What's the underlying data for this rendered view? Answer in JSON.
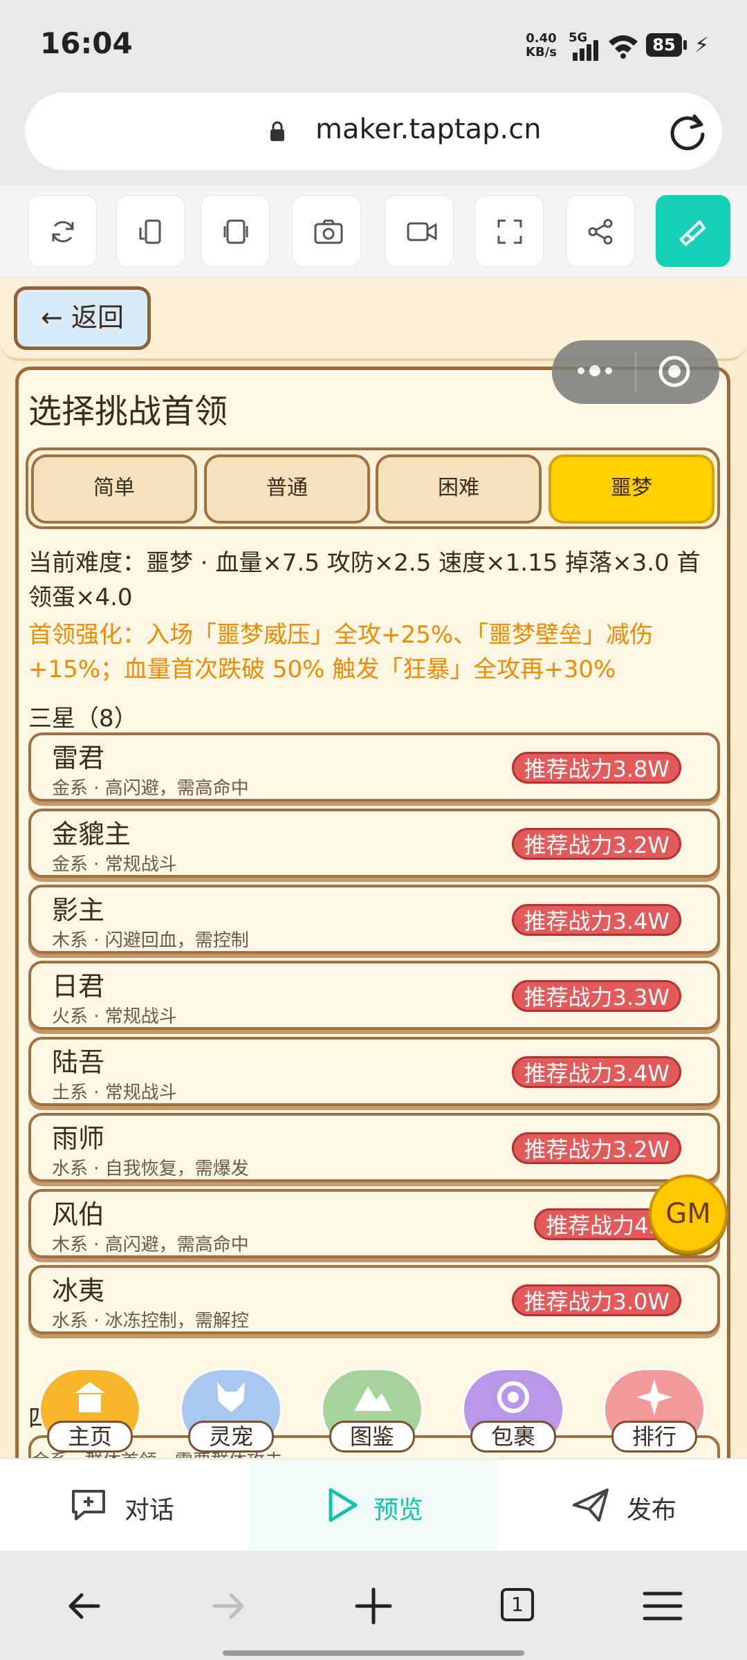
{
  "status_bar": {
    "time": "16:04",
    "net_speed_value": "0.40",
    "net_speed_unit": "KB/s",
    "network": "5G",
    "battery": "85"
  },
  "browser": {
    "url": "maker.taptap.cn",
    "accent_color": "#14d1b8"
  },
  "toolbar": {
    "icons": [
      "refresh-icon",
      "phone-rotate-icon",
      "duplicate-icon",
      "camera-icon",
      "video-icon",
      "fullscreen-icon",
      "share-icon",
      "edit-icon"
    ]
  },
  "game": {
    "back_label": "← 返回",
    "panel_title": "选择挑战首领",
    "difficulties": [
      "简单",
      "普通",
      "困难",
      "噩梦"
    ],
    "active_difficulty": "噩梦",
    "current_difficulty_text": "当前难度：噩梦 · 血量×7.5 攻防×2.5 速度×1.15 掉落×3.0 首领蛋×4.0",
    "boost_text": "首领强化：入场「噩梦威压」全攻+25%、「噩梦壁垒」减伤+15%；血量首次跌破 50% 触发「狂暴」全攻再+30%",
    "section_3_label": "三星（8）",
    "bosses": [
      {
        "name": "雷君",
        "desc": "金系 · 高闪避，需高命中",
        "power": "推荐战力3.8W"
      },
      {
        "name": "金貔主",
        "desc": "金系 · 常规战斗",
        "power": "推荐战力3.2W"
      },
      {
        "name": "影主",
        "desc": "木系 · 闪避回血，需控制",
        "power": "推荐战力3.4W"
      },
      {
        "name": "日君",
        "desc": "火系 · 常规战斗",
        "power": "推荐战力3.3W"
      },
      {
        "name": "陆吾",
        "desc": "土系 · 常规战斗",
        "power": "推荐战力3.4W"
      },
      {
        "name": "雨师",
        "desc": "水系 · 自我恢复，需爆发",
        "power": "推荐战力3.2W"
      },
      {
        "name": "风伯",
        "desc": "木系 · 高闪避，需高命中",
        "power": "推荐战力4.3"
      },
      {
        "name": "冰夷",
        "desc": "水系 · 冰冻控制，需解控",
        "power": "推荐战力3.0W"
      }
    ],
    "section_4_label": "四",
    "partial_boss_desc": "金系 · 群体首领，需要群体攻击",
    "gm_label": "GM",
    "bottom_nav": [
      {
        "label": "主页",
        "icon": "temple-icon",
        "color": "#f6b52a"
      },
      {
        "label": "灵宠",
        "icon": "fox-icon",
        "color": "#a9c8ef"
      },
      {
        "label": "图鉴",
        "icon": "mountain-icon",
        "color": "#a6d39a"
      },
      {
        "label": "包裹",
        "icon": "vortex-icon",
        "color": "#b896e8"
      },
      {
        "label": "排行",
        "icon": "flower-icon",
        "color": "#f29a9a"
      }
    ]
  },
  "tabs": [
    {
      "label": "对话",
      "icon": "chat-icon"
    },
    {
      "label": "预览",
      "icon": "play-icon"
    },
    {
      "label": "发布",
      "icon": "send-icon"
    }
  ],
  "active_tab": "预览",
  "system_nav": {
    "tab_count": "1"
  }
}
